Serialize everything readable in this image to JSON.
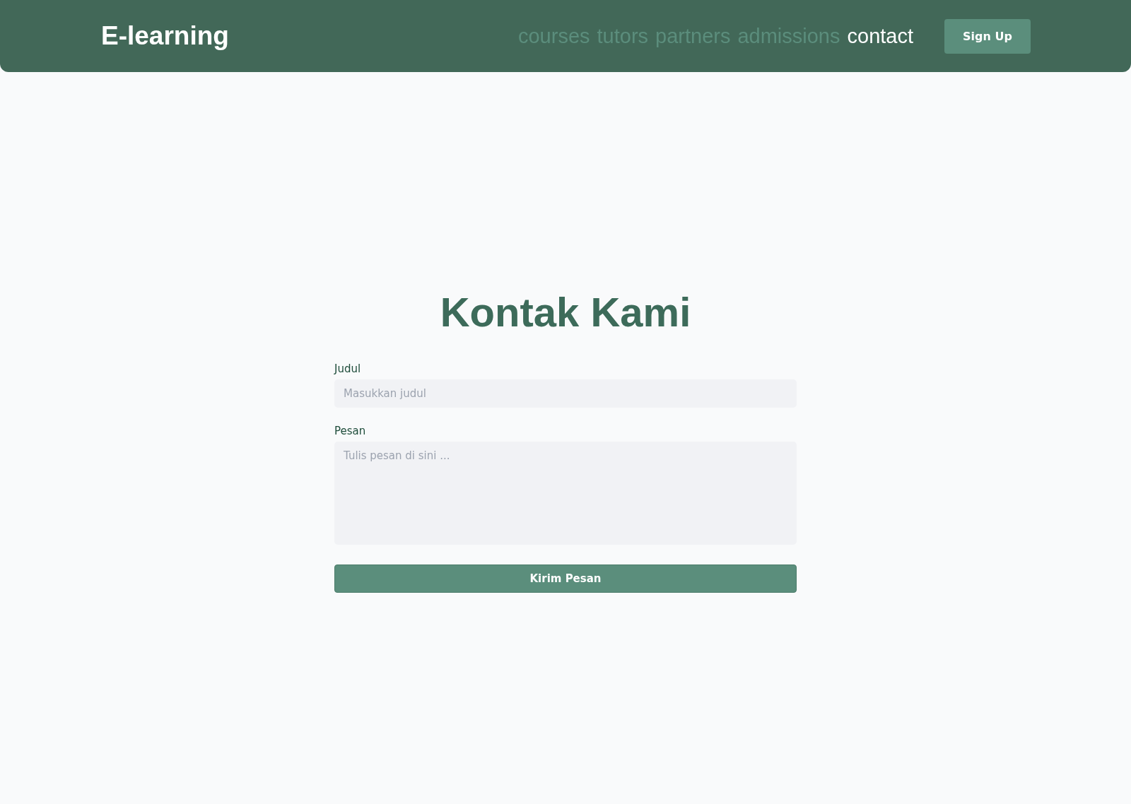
{
  "header": {
    "logo": "E-learning",
    "nav": [
      {
        "label": "courses",
        "selected": false
      },
      {
        "label": "tutors",
        "selected": false
      },
      {
        "label": "partners",
        "selected": false
      },
      {
        "label": "admissions",
        "selected": false
      },
      {
        "label": "contact",
        "selected": true
      }
    ],
    "signup": "Sign Up"
  },
  "form": {
    "title": "Kontak Kami",
    "fields": [
      {
        "kind": "input",
        "label": "Judul",
        "placeholder": "Masukkan judul"
      },
      {
        "kind": "textarea",
        "label": "Pesan",
        "placeholder": "Tulis pesan di sini ..."
      }
    ],
    "submit": "Kirim Pesan"
  }
}
